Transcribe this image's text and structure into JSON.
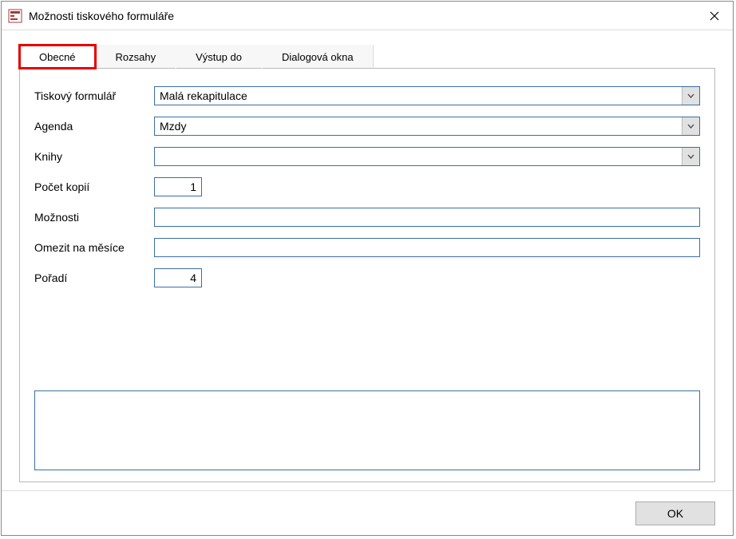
{
  "window": {
    "title": "Možnosti tiskového formuláře"
  },
  "tabs": [
    {
      "label": "Obecné",
      "active": true,
      "highlighted": true
    },
    {
      "label": "Rozsahy",
      "active": false,
      "highlighted": false
    },
    {
      "label": "Výstup do",
      "active": false,
      "highlighted": false
    },
    {
      "label": "Dialogová okna",
      "active": false,
      "highlighted": false
    }
  ],
  "form": {
    "print_form": {
      "label": "Tiskový formulář",
      "value": "Malá rekapitulace"
    },
    "agenda": {
      "label": "Agenda",
      "value": "Mzdy"
    },
    "books": {
      "label": "Knihy",
      "value": ""
    },
    "copies": {
      "label": "Počet kopií",
      "value": "1"
    },
    "options": {
      "label": "Možnosti",
      "value": ""
    },
    "months": {
      "label": "Omezit na měsíce",
      "value": ""
    },
    "order": {
      "label": "Pořadí",
      "value": "4"
    },
    "notes": {
      "value": ""
    }
  },
  "footer": {
    "ok_label": "OK"
  }
}
